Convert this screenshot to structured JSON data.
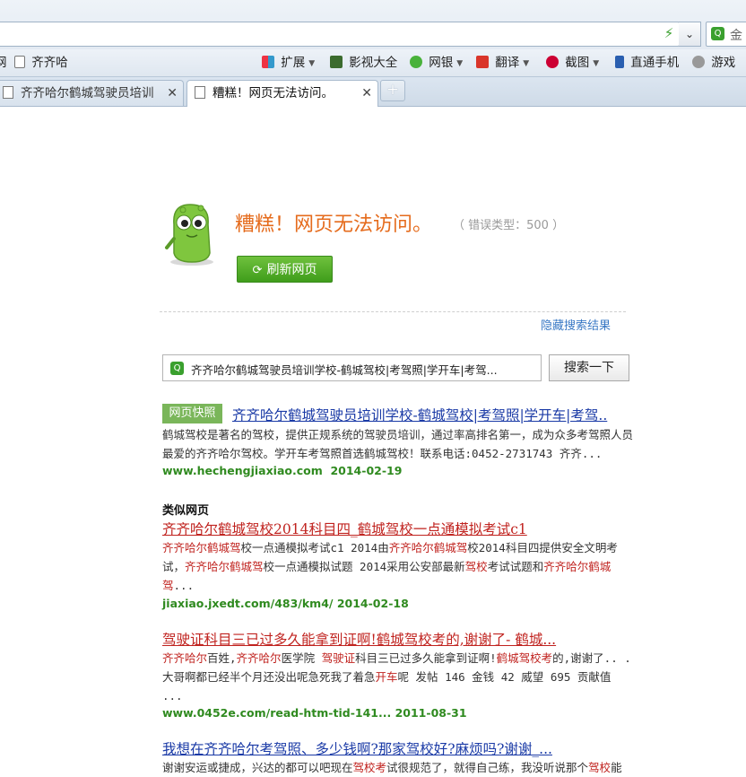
{
  "browser": {
    "search_partial": "金",
    "favorites": {
      "first_partial": "网",
      "qiqihaer": "齐齐哈",
      "extend": "扩展",
      "video": "影视大全",
      "bank": "网银",
      "translate": "翻译",
      "screenshot": "截图",
      "phone": "直通手机",
      "games": "游戏"
    },
    "tabs": [
      {
        "label": "齐齐哈尔鹤城驾驶员培训",
        "close": "✕"
      },
      {
        "label": "糟糕！网页无法访问。",
        "close": "✕"
      }
    ],
    "new_tab": "+"
  },
  "error": {
    "title": "糟糕！网页无法访问。",
    "code": "（ 错误类型：500 ）",
    "refresh_label": "刷新网页",
    "hide_results": "隐藏搜索结果"
  },
  "search": {
    "value": "齐齐哈尔鹤城驾驶员培训学校-鹤城驾校|考驾照|学开车|考驾...",
    "button": "搜索一下"
  },
  "snapshot_badge": "网页快照",
  "results": [
    {
      "title": "齐齐哈尔鹤城驾驶员培训学校-鹤城驾校|考驾照|学开车|考驾..",
      "desc": "鹤城驾校是著名的驾校，提供正规系统的驾驶员培训，通过率高排名第一，成为众多考驾照人员最爱的齐齐哈尔驾校。学开车考驾照首选鹤城驾校！联系电话:0452-2731743 齐齐...",
      "url": "www.hechengjiaxiao.com",
      "date": "2014-02-19"
    }
  ],
  "similar_heading": "类似网页",
  "similar": [
    {
      "title": "齐齐哈尔鹤城驾校2014科目四_鹤城驾校一点通模拟考试c1",
      "desc_parts": [
        "齐齐哈尔鹤城驾",
        "校一点通模拟考试c1 2014由",
        "齐齐哈尔鹤城驾",
        "校2014科目四提供安全文明考试，",
        "齐齐哈尔鹤城驾",
        "校一点通模拟试题 2014采用公安部最新",
        "驾校",
        "考试试题和",
        "齐齐哈尔鹤城驾",
        "..."
      ],
      "url": "jiaxiao.jxedt.com/483/km4/",
      "date": "2014-02-18"
    },
    {
      "title": "驾驶证科目三已过多久能拿到证啊!鹤城驾校考的,谢谢了- 鹤城...",
      "desc_parts": [
        "齐齐哈尔",
        "百姓,",
        "齐齐哈尔",
        "医学院 ",
        "驾驶证",
        "科目三已过多久能拿到证啊!",
        "鹤城驾校考",
        "的,谢谢了.. . 大哥啊都已经半个月还没出呢急死我了着急",
        "开车",
        "呢 发帖 146 金钱 42 威望 695 贡献值 ..."
      ],
      "url": "www.0452e.com/read-htm-tid-141...",
      "date": "2011-08-31"
    },
    {
      "title": "我想在齐齐哈尔考驾照、多少钱啊?那家驾校好?麻烦吗?谢谢_...",
      "desc_parts": [
        "谢谢安运或捷成，兴达的都可以吧现在",
        "驾校考",
        "试很规范了，就得自己练，我没听说那个",
        "驾校",
        "能"
      ]
    }
  ]
}
